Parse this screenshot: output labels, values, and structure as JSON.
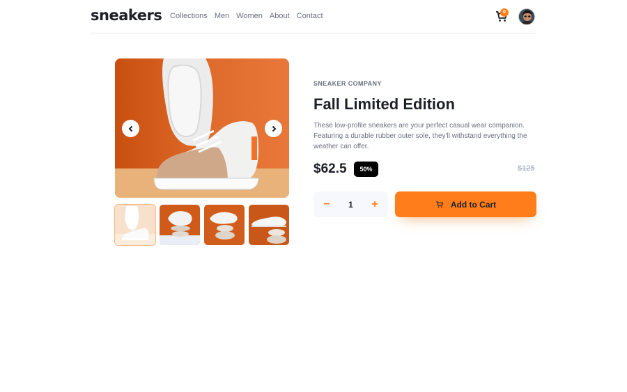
{
  "header": {
    "logo": "sneakers",
    "nav": [
      "Collections",
      "Men",
      "Women",
      "About",
      "Contact"
    ],
    "cart_count": "0"
  },
  "product": {
    "company": "SNEAKER COMPANY",
    "title": "Fall Limited Edition",
    "description": "These low-profile sneakers are your perfect casual wear companion. Featuring a durable rubber outer sole, they'll withstand everything the weather can offer.",
    "price": "$62.5",
    "discount": "50%",
    "original_price": "$125",
    "quantity": "1",
    "decrement_label": "−",
    "increment_label": "+",
    "add_to_cart_label": "Add to Cart"
  },
  "icons": {
    "cart": "cart-icon",
    "prev": "chevron-left-icon",
    "next": "chevron-right-icon"
  },
  "colors": {
    "accent": "#ff7d1a",
    "text_dark": "#1d2026",
    "text_gray": "#69707d"
  }
}
